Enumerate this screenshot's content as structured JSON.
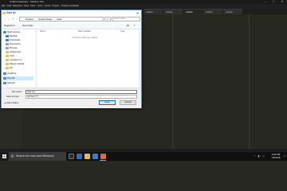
{
  "editor": {
    "title": "untitled (stephen) - Sublime Text",
    "menu": [
      "File",
      "Edit",
      "Selection",
      "Find",
      "View",
      "Goto",
      "Tools",
      "Project",
      "Preferences",
      "Help"
    ],
    "tabs": [
      "untitled",
      "untitled",
      "untitled",
      "untitled",
      "untitled"
    ]
  },
  "dialog": {
    "title": "Save As",
    "close_glyph": "✕",
    "breadcrumb": [
      "Desktop",
      "stephen/blogs",
      "static"
    ],
    "search_placeholder": "Search static",
    "toolbar": {
      "organize": "Organize ▾",
      "new_folder": "New folder"
    },
    "nav_items": [
      {
        "label": "Quick access",
        "color": "#3b8ee8"
      },
      {
        "label": "Desktop",
        "color": "#2f7fd6"
      },
      {
        "label": "Downloads",
        "color": "#2f7fd6"
      },
      {
        "label": "Documents",
        "color": "#8aa2c0"
      },
      {
        "label": "Pictures",
        "color": "#8aa2c0"
      },
      {
        "label": "Assignment",
        "color": "#e8c25a"
      },
      {
        "label": "CSS",
        "color": "#e8c25a"
      },
      {
        "label": "Contacts 2.2",
        "color": "#e8c25a"
      },
      {
        "label": "Django Tutorial",
        "color": "#e8c25a"
      },
      {
        "label": "ted",
        "color": "#e8c25a"
      },
      {
        "label": "OneDrive",
        "color": "#3b8ee8"
      },
      {
        "label": "This PC",
        "color": "#4a90d9"
      },
      {
        "label": "Network",
        "color": "#4a90d9"
      }
    ],
    "columns": {
      "name": "Name",
      "date": "Date modified",
      "type": "Type"
    },
    "empty_message": "No items match your search.",
    "file_name_label": "File name:",
    "file_name_value": "style.css",
    "save_type_label": "Save as type:",
    "save_type_value": "All Files (*.*)",
    "hide_folders": "▲ Hide Folders",
    "save_button": "Save",
    "cancel_button": "Cancel"
  },
  "taskbar": {
    "search_placeholder": "Search the web and Windows",
    "time": "9:23 PM",
    "date": "1/5/2016"
  },
  "colors": {
    "editor_bg": "#272822",
    "taskbar_bg": "#101010",
    "accent": "#0078d7"
  }
}
